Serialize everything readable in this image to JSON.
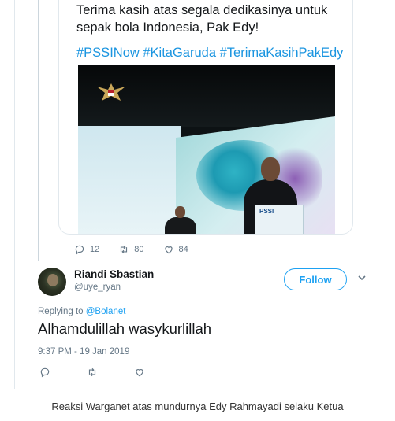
{
  "quoted_tweet": {
    "text": "Terima kasih atas segala dedikasinya untuk sepak bola Indonesia, Pak Edy!",
    "hashtags": "#PSSINow #KitaGaruda #TerimaKasihPakEdy",
    "photo": {
      "podium_logo": "PSSI"
    },
    "actions": {
      "reply_count": "12",
      "retweet_count": "80",
      "like_count": "84"
    }
  },
  "reply_tweet": {
    "user_name": "Riandi Sbastian",
    "user_handle": "@uye_ryan",
    "follow_label": "Follow",
    "replying_prefix": "Replying to",
    "replying_to": "@Bolanet",
    "text": "Alhamdulillah wasykurlillah",
    "timestamp": "9:37 PM - 19 Jan 2019"
  },
  "caption": "Reaksi Warganet atas mundurnya Edy Rahmayadi selaku Ketua",
  "colors": {
    "link": "#1da1f2",
    "muted": "#657786",
    "text": "#14171a"
  },
  "icons": [
    "reply-icon",
    "retweet-icon",
    "like-icon",
    "chevron-down-icon"
  ]
}
